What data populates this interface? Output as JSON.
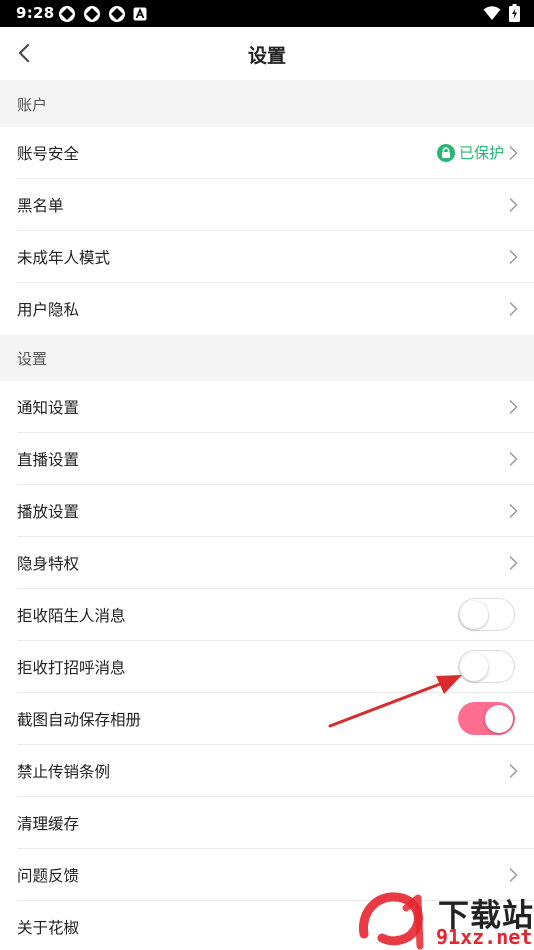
{
  "status_bar": {
    "time": "9:28",
    "icons": [
      "notification-app-icon",
      "notification-app-icon",
      "notification-app-icon",
      "a-icon",
      "wifi-icon",
      "battery-icon"
    ]
  },
  "header": {
    "title": "设置",
    "back_icon": "chevron-left-icon"
  },
  "sections": [
    {
      "label": "账户",
      "items": [
        {
          "label": "账号安全",
          "status": "已保护",
          "status_icon": "lock-icon",
          "status_color": "#2bb673"
        },
        {
          "label": "黑名单"
        },
        {
          "label": "未成年人模式"
        },
        {
          "label": "用户隐私"
        }
      ]
    },
    {
      "label": "设置",
      "items": [
        {
          "label": "通知设置"
        },
        {
          "label": "直播设置"
        },
        {
          "label": "播放设置"
        },
        {
          "label": "隐身特权"
        },
        {
          "label": "拒收陌生人消息",
          "toggle": "off"
        },
        {
          "label": "拒收打招呼消息",
          "toggle": "off"
        },
        {
          "label": "截图自动保存相册",
          "toggle": "on"
        },
        {
          "label": "禁止传销条例"
        },
        {
          "label": "清理缓存"
        },
        {
          "label": "问题反馈"
        },
        {
          "label": "关于花椒"
        }
      ]
    }
  ],
  "colors": {
    "toggle_on": "#ff6d8f",
    "section_bg": "#f4f4f4",
    "annotation_arrow": "#d92b2b"
  },
  "watermark": {
    "text": "下载站",
    "url": "91xz.net"
  }
}
